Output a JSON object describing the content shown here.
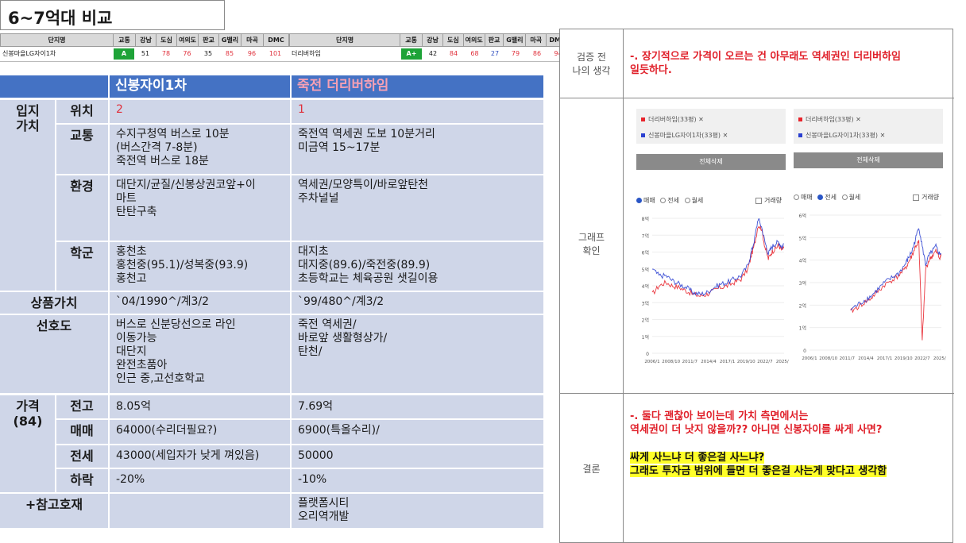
{
  "page": {
    "title": "6~7억대 비교"
  },
  "score_table": {
    "headers": [
      "단지명",
      "교통",
      "강남",
      "도심",
      "여의도",
      "판교",
      "G밸리",
      "마곡",
      "DMC"
    ],
    "left": {
      "name": "신봉마을LG자이1차",
      "grade": "A",
      "scores": [
        "51",
        "78",
        "76",
        "35",
        "85",
        "96",
        "101"
      ]
    },
    "right": {
      "name": "더리버하임",
      "grade": "A+",
      "scores": [
        "42",
        "84",
        "68",
        "27",
        "79",
        "86",
        "94"
      ]
    }
  },
  "comparison": {
    "col_left": "신봉자이1차",
    "col_right": "죽전 더리버하임",
    "group_ipji": "입지\n가치",
    "group_price": "가격\n(84)",
    "rows": {
      "location": {
        "label": "위치",
        "left": "2",
        "right": "1"
      },
      "transport": {
        "label": "교통",
        "left": "수지구청역 버스로 10분\n(버스간격 7-8분)\n죽전역 버스로 18분",
        "right": "죽전역 역세권 도보 10분거리\n미금역 15~17분"
      },
      "environment": {
        "label": "환경",
        "left": "대단지/균질/신봉상권코앞+이\n마트\n탄탄구축",
        "right": "역세권/모양특이/바로앞탄천\n주차널널"
      },
      "school": {
        "label": "학군",
        "left": "홍천초\n홍천중(95.1)/성복중(93.9)\n홍천고",
        "right": "대지초\n대지중(89.6)/죽전중(89.9)\n초등학교는 체육공원 샛길이용"
      },
      "product": {
        "label": "상품가치",
        "left": "`04/1990^/계3/2",
        "right": "`99/480^/계3/2"
      },
      "preference": {
        "label": "선호도",
        "left": "버스로 신분당선으로 라인\n이동가능\n대단지\n완전초품아\n인근 중,고선호학교",
        "right": "죽전 역세권/\n바로앞 생활형상가/\n탄천/"
      },
      "peak": {
        "label": "전고",
        "left": "8.05억",
        "right": "7.69억"
      },
      "sale": {
        "label": "매매",
        "left": "64000(수리더필요?)",
        "right": "6900(특올수리)/"
      },
      "jeonse": {
        "label": "전세",
        "left": "43000(세입자가 낮게 껴있음)",
        "right": "50000"
      },
      "drop": {
        "label": "하락",
        "left": "-20%",
        "right": "-10%"
      },
      "reference": {
        "label": "+참고호재",
        "left": "",
        "right": "플랫폼시티\n오리역개발"
      }
    }
  },
  "review": {
    "label_thought": "검증 전\n나의 생각",
    "thought_text": "-. 장기적으로 가격이 오르는 건 아무래도 역세권인 더리버하임\n일듯하다.",
    "label_graph": "그래프\n확인",
    "label_conclusion": "결론",
    "conclusion_text": "-. 둘다 괜찮아 보이는데 가치 측면에서는\n역세권이 더 낫지 않을까?? 아니면 신봉자이를 싸게 사면?",
    "conclusion_highlight_1": "싸게 사느냐 더 좋은걸 사느냐?",
    "conclusion_highlight_2": "그래도 투자금 범위에 들면 더 좋은걸 사는게 맞다고 생각함"
  },
  "graphs": {
    "legend_a": "더리버하임(33평)",
    "legend_b": "신봉마을LG자이1차(33평)",
    "close_mark": "✕",
    "clear_button": "전체삭제",
    "radio_sale": "매매",
    "radio_jeonse": "전세",
    "radio_monthly": "월세",
    "check_volume": "거래량",
    "x_ticks": [
      "2006/1",
      "2008/10",
      "2011/7",
      "2014/4",
      "2017/1",
      "2019/10",
      "2022/7",
      "2025/4"
    ],
    "left_y_ticks": [
      "0",
      "1억",
      "2억",
      "3억",
      "4억",
      "5억",
      "6억",
      "7억",
      "8억"
    ],
    "right_y_ticks": [
      "0",
      "1억",
      "2억",
      "3억",
      "4억",
      "5억",
      "6억"
    ],
    "colors": {
      "a": "#e8242c",
      "b": "#2a3fd0"
    }
  },
  "chart_data": [
    {
      "type": "line",
      "title": "",
      "xlabel": "",
      "ylabel": "",
      "x": [
        "2006/1",
        "2007/1",
        "2008/1",
        "2009/1",
        "2010/1",
        "2011/1",
        "2012/1",
        "2013/1",
        "2014/1",
        "2015/1",
        "2016/1",
        "2017/1",
        "2018/1",
        "2019/1",
        "2020/1",
        "2020/7",
        "2021/1",
        "2021/7",
        "2022/1",
        "2022/7",
        "2023/1",
        "2023/7",
        "2024/1",
        "2024/7",
        "2025/1",
        "2025/4"
      ],
      "series": [
        {
          "name": "더리버하임(33평)",
          "values": [
            3.5,
            4.0,
            4.2,
            4.0,
            3.9,
            3.7,
            3.5,
            3.4,
            3.5,
            3.7,
            3.9,
            4.0,
            4.2,
            4.4,
            5.0,
            5.8,
            6.5,
            7.6,
            7.4,
            6.3,
            5.6,
            6.0,
            6.2,
            6.4,
            6.1,
            6.3
          ]
        },
        {
          "name": "신봉마을LG자이1차(33평)",
          "values": [
            5.0,
            4.6,
            4.6,
            4.3,
            4.1,
            3.9,
            3.6,
            3.5,
            3.6,
            3.9,
            4.1,
            4.2,
            4.4,
            4.6,
            5.2,
            6.0,
            6.8,
            8.0,
            7.5,
            6.6,
            5.9,
            6.3,
            6.5,
            6.6,
            6.3,
            6.5
          ]
        }
      ],
      "ylim": [
        0,
        8
      ]
    },
    {
      "type": "line",
      "title": "",
      "xlabel": "",
      "ylabel": "",
      "x": [
        "2012/1",
        "2013/1",
        "2014/1",
        "2015/1",
        "2016/1",
        "2017/1",
        "2018/1",
        "2019/1",
        "2020/1",
        "2020/7",
        "2021/1",
        "2021/7",
        "2022/1",
        "2022/7",
        "2023/1",
        "2023/7",
        "2024/1",
        "2024/7",
        "2025/1",
        "2025/4"
      ],
      "series": [
        {
          "name": "더리버하임(33평)",
          "values": [
            1.7,
            1.9,
            2.1,
            2.3,
            2.6,
            2.9,
            3.1,
            3.3,
            3.6,
            3.9,
            4.2,
            4.6,
            4.8,
            0.4,
            3.6,
            4.0,
            4.2,
            4.4,
            4.1,
            4.2
          ]
        },
        {
          "name": "신봉마을LG자이1차(33평)",
          "values": [
            1.8,
            2.0,
            2.2,
            2.4,
            2.7,
            3.0,
            3.2,
            3.4,
            3.8,
            4.1,
            4.4,
            4.9,
            5.5,
            4.6,
            3.8,
            4.2,
            4.4,
            4.6,
            4.3,
            4.3
          ]
        }
      ],
      "ylim": [
        0,
        6
      ]
    }
  ]
}
